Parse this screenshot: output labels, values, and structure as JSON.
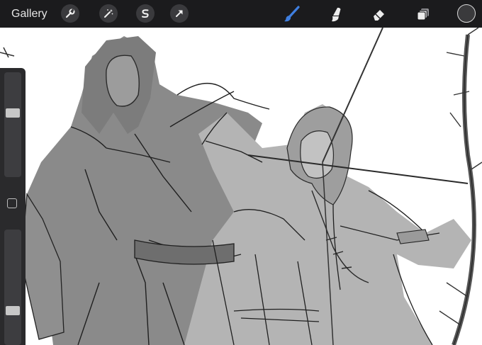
{
  "toolbar": {
    "gallery_label": "Gallery",
    "left_tools": [
      {
        "name": "wrench-icon"
      },
      {
        "name": "magic-wand-icon"
      },
      {
        "name": "selection-icon"
      },
      {
        "name": "transform-arrow-icon"
      }
    ],
    "right_tools": [
      {
        "name": "brush-icon",
        "active": true
      },
      {
        "name": "smudge-icon"
      },
      {
        "name": "eraser-icon"
      },
      {
        "name": "layers-icon"
      }
    ],
    "current_color": "#3a3a3c",
    "accent_color": "#3f7fe0"
  },
  "sidebar": {
    "brush_size_level": 0.38,
    "opacity_level": 0.72
  }
}
